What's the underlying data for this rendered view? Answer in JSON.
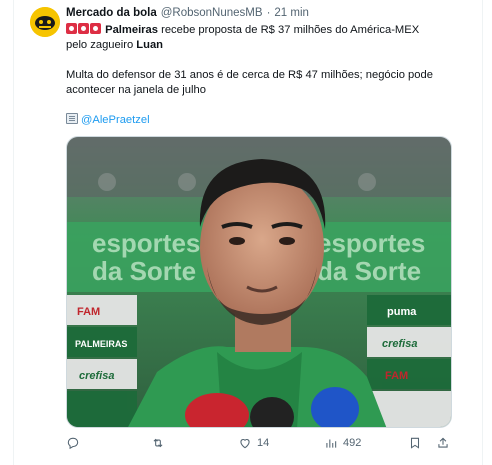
{
  "tweet": {
    "author_name": "Mercado da bola",
    "author_handle": "@RobsonNunesMB",
    "separator": "·",
    "time": "21 min",
    "line1_bold": "Palmeiras",
    "line1_rest": " recebe proposta de R$ 37 milhões do América-MEX",
    "line2_prefix": "pelo zagueiro ",
    "line2_bold": "Luan",
    "paragraph2": "Multa do defensor de 31 anos é de cerca de R$ 47 milhões; negócio pode acontecer na janela de julho",
    "mention": "@AlePraetzel"
  },
  "media": {
    "backdrop_lines": [
      "esportes",
      "da Sorte"
    ],
    "sponsor_words": [
      "FAM",
      "PALMEIRAS",
      "crefisa",
      "puma",
      "crefisa",
      "FAM"
    ]
  },
  "actions": {
    "reply_icon": "reply-icon",
    "retweet_icon": "retweet-icon",
    "like_icon": "heart-icon",
    "like_count": "14",
    "views_icon": "views-icon",
    "view_count": "492",
    "bookmark_icon": "bookmark-icon",
    "share_icon": "share-icon"
  },
  "colors": {
    "accent": "#1d9bf0",
    "muted": "#536471",
    "green": "#1a7a3e"
  }
}
